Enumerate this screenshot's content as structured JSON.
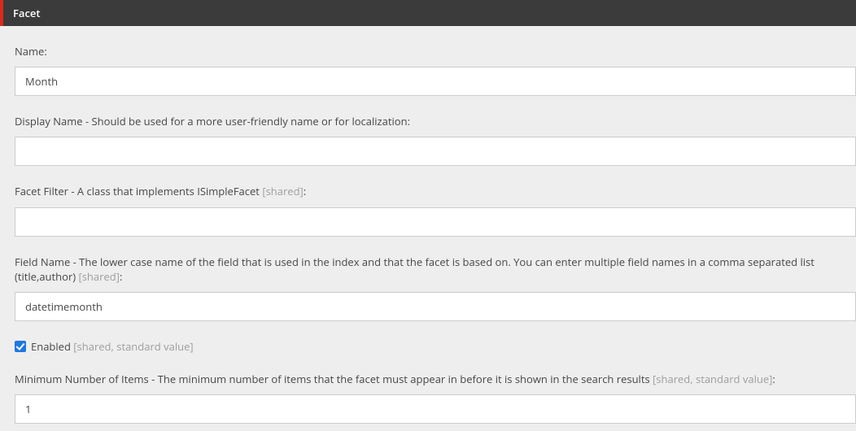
{
  "header": {
    "title": "Facet"
  },
  "fields": {
    "name": {
      "label": "Name:",
      "value": "Month"
    },
    "displayName": {
      "label": "Display Name - Should be used for a more user-friendly name or for localization:",
      "value": ""
    },
    "facetFilter": {
      "labelPrefix": "Facet Filter - A class that implements ISimpleFacet ",
      "labelMeta": "[shared]",
      "labelSuffix": ":",
      "value": ""
    },
    "fieldName": {
      "labelPrefix": "Field Name - The lower case name of the field that is used in the index and that the facet is based on. You can enter multiple field names in a comma separated list (title,author) ",
      "labelMeta": "[shared]",
      "labelSuffix": ":",
      "value": "datetimemonth"
    },
    "enabled": {
      "label": "Enabled ",
      "meta": "[shared, standard value]",
      "checked": true
    },
    "minItems": {
      "labelPrefix": "Minimum Number of Items - The minimum number of items that the facet must appear in before it is shown in the search results ",
      "labelMeta": "[shared, standard value]",
      "labelSuffix": ":",
      "value": "1"
    }
  }
}
